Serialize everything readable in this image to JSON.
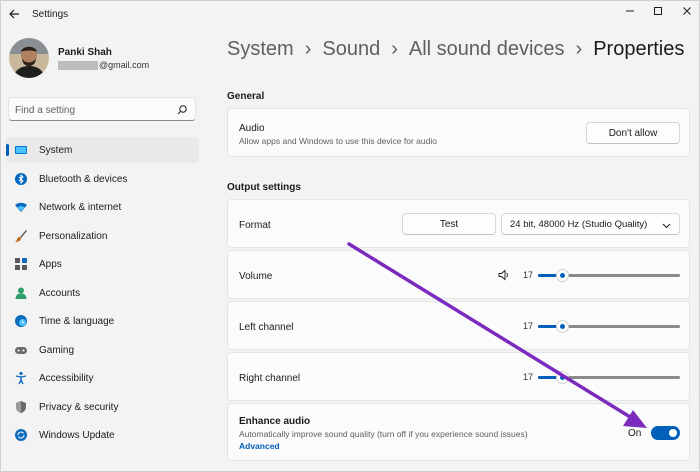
{
  "window": {
    "title": "Settings",
    "controls": [
      "minimize",
      "maximize",
      "close"
    ]
  },
  "profile": {
    "name": "Panki Shah",
    "email_suffix": "@gmail.com"
  },
  "search": {
    "placeholder": "Find a setting"
  },
  "sidebar": {
    "items": [
      {
        "label": "System",
        "icon": "system-icon",
        "active": true,
        "color": "#0078d4"
      },
      {
        "label": "Bluetooth & devices",
        "icon": "bluetooth-icon",
        "color": "#0067c0"
      },
      {
        "label": "Network & internet",
        "icon": "network-icon",
        "color": "#0f6cbd"
      },
      {
        "label": "Personalization",
        "icon": "brush-icon",
        "color": "#c06a1c"
      },
      {
        "label": "Apps",
        "icon": "apps-icon",
        "color": "#5a5a5a"
      },
      {
        "label": "Accounts",
        "icon": "accounts-icon",
        "color": "#2e9e6a"
      },
      {
        "label": "Time & language",
        "icon": "globe-icon",
        "color": "#0f6cbd"
      },
      {
        "label": "Gaming",
        "icon": "gaming-icon",
        "color": "#6b6b6b"
      },
      {
        "label": "Accessibility",
        "icon": "accessibility-icon",
        "color": "#0f6cbd"
      },
      {
        "label": "Privacy & security",
        "icon": "shield-icon",
        "color": "#6b6b6b"
      },
      {
        "label": "Windows Update",
        "icon": "update-icon",
        "color": "#0f6cbd"
      }
    ]
  },
  "breadcrumb": {
    "items": [
      "System",
      "Sound",
      "All sound devices"
    ],
    "current": "Properties",
    "separator": "›"
  },
  "general": {
    "heading": "General",
    "audio": {
      "title": "Audio",
      "subtitle": "Allow apps and Windows to use this device for audio",
      "button": "Don't allow"
    }
  },
  "output": {
    "heading": "Output settings",
    "format": {
      "title": "Format",
      "test_button": "Test",
      "selected": "24 bit, 48000 Hz (Studio Quality)"
    },
    "volume": {
      "title": "Volume",
      "value": "17",
      "level": 0.17
    },
    "left_channel": {
      "title": "Left channel",
      "value": "17",
      "level": 0.17
    },
    "right_channel": {
      "title": "Right channel",
      "value": "17",
      "level": 0.17
    },
    "enhance": {
      "title": "Enhance audio",
      "subtitle": "Automatically improve sound quality (turn off if you experience sound issues)",
      "link": "Advanced",
      "state_label": "On",
      "on": true
    }
  },
  "colors": {
    "accent": "#005fb8",
    "annotation_arrow": "#7b2cbf"
  }
}
